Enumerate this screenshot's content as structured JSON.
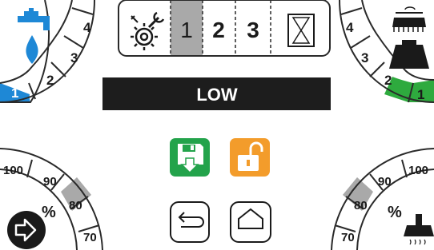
{
  "colors": {
    "accent_blue": "#1e88d6",
    "accent_green": "#2eaa3e",
    "gray_segment": "#a9a9a9",
    "save_green": "#23a34b",
    "lock_orange": "#f39c2b",
    "banner_black": "#1d1d1d",
    "line": "#2a2a2a"
  },
  "banner": {
    "text": "LOW"
  },
  "top_bar": {
    "items": [
      {
        "icon": "settings-gear-icon"
      },
      {
        "label": "1",
        "selected": true
      },
      {
        "label": "2",
        "selected": false
      },
      {
        "label": "3",
        "selected": false
      },
      {
        "icon": "hourglass-icon"
      }
    ]
  },
  "water_dial": {
    "icon": "water-tap-icon",
    "labels": [
      "1",
      "2",
      "3",
      "4"
    ],
    "selected": "1"
  },
  "pressure_dial": {
    "icon": "brush-weight-icon",
    "labels": [
      "1",
      "2",
      "3",
      "4"
    ],
    "selected": [
      "1",
      "2"
    ]
  },
  "left_percent_dial": {
    "unit": "%",
    "labels": [
      "100",
      "90",
      "80",
      "70"
    ],
    "selected": "80",
    "icon": "arrow-right-circle-icon"
  },
  "right_percent_dial": {
    "unit": "%",
    "labels": [
      "100",
      "90",
      "80",
      "70"
    ],
    "selected": "80",
    "icon": "vacuum-suction-icon"
  },
  "actions": {
    "save_icon": "save-disk-icon",
    "unlock_icon": "unlock-icon",
    "back_icon": "back-arrow-icon",
    "home_icon": "home-icon"
  }
}
